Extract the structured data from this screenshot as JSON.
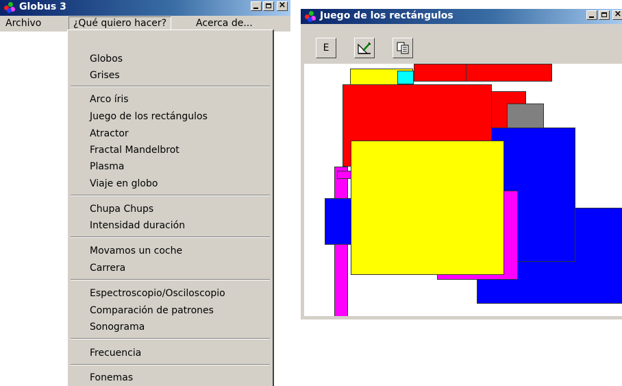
{
  "window1": {
    "title": "Globus 3",
    "menu": {
      "archivo": "Archivo",
      "que_quiero": "¿Qué quiero hacer?",
      "acerca": "Acerca de..."
    }
  },
  "dropdown": {
    "items": [
      "Globos",
      "Grises",
      "Arco íris",
      "Juego de los rectángulos",
      "Atractor",
      "Fractal Mandelbrot",
      "Plasma",
      "Viaje en globo",
      "Chupa Chups",
      "Intensidad duración",
      "Movamos un coche",
      "Carrera",
      "Espectroscopio/Osciloscopio",
      "Comparación de patrones",
      "Sonograma",
      "Frecuencia",
      "Fonemas"
    ]
  },
  "window2": {
    "title": "Juego de los rectángulos",
    "toolbar": {
      "e_label": "E"
    }
  },
  "colors": {
    "title_gradient_start": "#0a246a",
    "title_gradient_end": "#a6caf0",
    "face": "#d4d0c8",
    "canvas": "#ffffff",
    "rect_red": "#ff0000",
    "rect_yellow": "#ffff00",
    "rect_blue": "#0000ff",
    "rect_magenta": "#ff00ff",
    "rect_cyan": "#00ffff",
    "rect_gray": "#808080"
  },
  "icons": [
    "app-globe-icon",
    "minimize-icon",
    "maximize-icon",
    "close-icon",
    "ruler-pencil-icon",
    "copy-icon"
  ]
}
